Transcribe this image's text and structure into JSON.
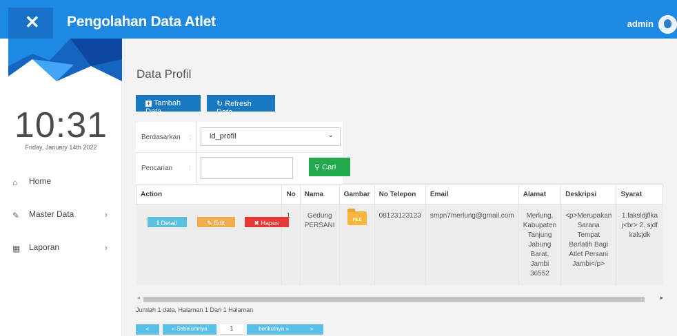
{
  "header": {
    "close_label": "✕",
    "title": "Pengolahan Data Atlet",
    "user": "admin"
  },
  "sidebar": {
    "clock": "10:31",
    "date": "Friday, January 14th 2022",
    "items": [
      {
        "label": "Home",
        "icon": "home-icon",
        "glyph": "⌂",
        "arrow": ""
      },
      {
        "label": "Master Data",
        "icon": "edit-icon",
        "glyph": "✎",
        "arrow": "›"
      },
      {
        "label": "Laporan",
        "icon": "calendar-icon",
        "glyph": "▦",
        "arrow": "›"
      }
    ]
  },
  "main": {
    "page_title": "Data Profil",
    "add_button": "Tambah Data",
    "refresh_button": "Refresh Data",
    "filter": {
      "by_label": "Berdasarkan",
      "colon": ":",
      "by_value": "id_profil",
      "search_label": "Pencarian",
      "search_value": "",
      "search_button": "Cari"
    },
    "table": {
      "headers": [
        "Action",
        "No",
        "Nama",
        "Gambar",
        "No Telepon",
        "Email",
        "Alamat",
        "Deskripsi",
        "Syarat"
      ],
      "actions": {
        "detail": "Detail",
        "edit": "Edit",
        "delete": "Hapus"
      },
      "row": {
        "no": "1",
        "nama": "Gedung PERSANI",
        "gambar": "FILE",
        "telepon": "08123123123",
        "email": "smpn7merlung@gmail.com",
        "alamat": "Merlung, Kabupaten Tanjung Jabung Barat, Jambi 36552",
        "deskripsi": "<p>Merupakan Sarana Tempat Berlatih Bagi Atlet Persani Jambi</p>",
        "syarat": "1.faksldjflka j<br> 2. sjdfkalsjdk"
      }
    },
    "info": "Jumlah 1 data, Halaman 1 Dari 1 Halaman",
    "pagination": {
      "first": "«",
      "prev": "« Sebelumnya",
      "page": "1",
      "next": "berikutnya »",
      "last": "»"
    }
  },
  "colors": {
    "primary": "#1e88e5",
    "button_blue": "#1978c0",
    "success": "#22a94d",
    "info": "#5bc0de",
    "warning": "#f0ad4e",
    "danger": "#e53935"
  }
}
